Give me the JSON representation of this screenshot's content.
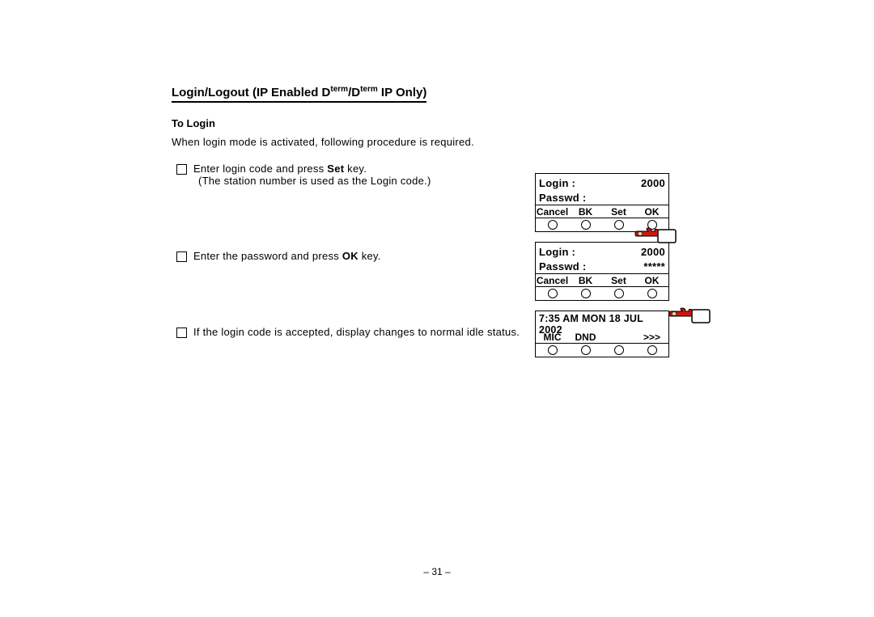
{
  "heading": {
    "pre": "Login/Logout (IP Enabled D",
    "sup1": "term",
    "mid": "/D",
    "sup2": "term",
    "post": " IP Only)"
  },
  "subhead": "To Login",
  "intro": "When login mode is activated, following procedure is required.",
  "steps": {
    "s1": {
      "pre": "Enter login code and press ",
      "bold": "Set",
      "post": " key.",
      "note": "(The station number is used as the Login code.)"
    },
    "s2": {
      "pre": "Enter the password and press ",
      "bold": "OK",
      "post": " key."
    },
    "s3": {
      "text": "If the login code is accepted, display changes to normal idle status."
    }
  },
  "displays": {
    "d1": {
      "login_label": "Login  :",
      "login_value": "2000",
      "passwd_label": "Passwd :",
      "passwd_value": "",
      "softkeys": [
        "Cancel",
        "BK",
        "Set",
        "OK"
      ]
    },
    "d2": {
      "login_label": "Login  :",
      "login_value": "2000",
      "passwd_label": "Passwd :",
      "passwd_value": "*****",
      "softkeys": [
        "Cancel",
        "BK",
        "Set",
        "OK"
      ]
    },
    "d3": {
      "line1": "7:35 AM MON 18 JUL  2002",
      "softkeys": [
        "MIC",
        "DND",
        "",
        ">>>"
      ]
    }
  },
  "page_number": "– 31 –"
}
